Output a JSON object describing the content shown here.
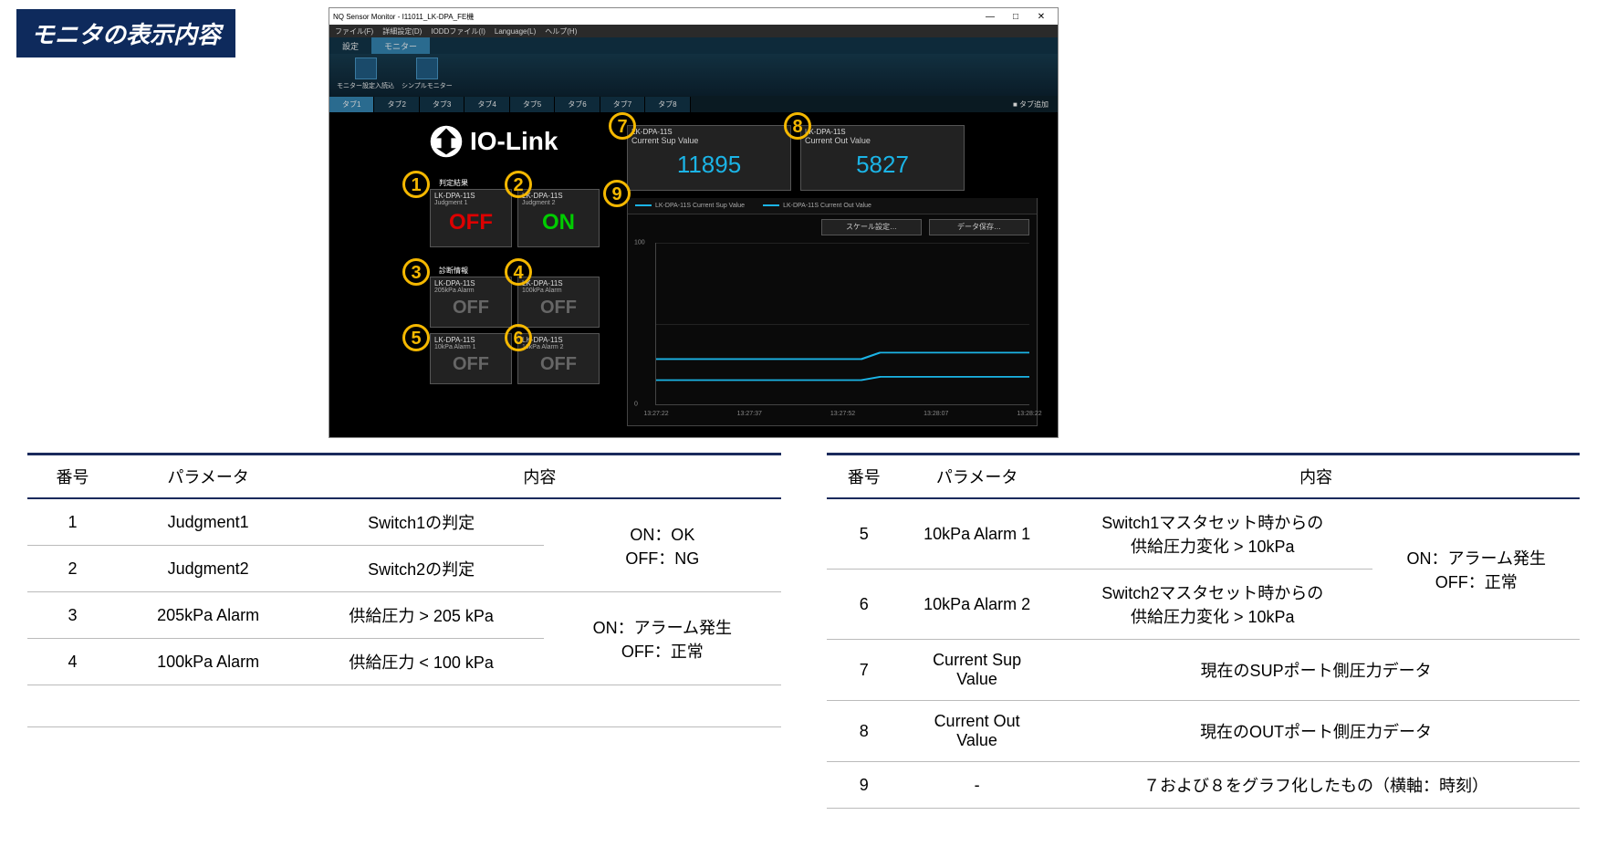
{
  "page_title": "モニタの表示内容",
  "window": {
    "title": "NQ Sensor Monitor - I11011_LK-DPA_FE機",
    "win_min": "—",
    "win_max": "□",
    "win_close": "✕",
    "menus": [
      "ファイル(F)",
      "詳細設定(D)",
      "IODDファイル(I)",
      "Language(L)",
      "ヘルプ(H)"
    ],
    "ribbon_tabs": [
      "設定",
      "モニター"
    ],
    "ribbon_items": [
      "モニター設定入読込",
      "シンプルモニター"
    ],
    "tabs": [
      "タブ1",
      "タブ2",
      "タブ3",
      "タブ4",
      "タブ5",
      "タブ6",
      "タブ7",
      "タブ8"
    ],
    "tab_add": "■ タブ追加"
  },
  "monitor": {
    "iolink_text": "IO-Link",
    "section_judgment": "判定結果",
    "section_diag": "診断情報",
    "panels": {
      "j1": {
        "model": "LK-DPA-11S",
        "sub": "Judgment 1",
        "value": "OFF"
      },
      "j2": {
        "model": "LK-DPA-11S",
        "sub": "Judgment 2",
        "value": "ON"
      },
      "d1": {
        "model": "LK-DPA-11S",
        "sub": "205kPa Alarm",
        "value": "OFF"
      },
      "d2": {
        "model": "LK-DPA-11S",
        "sub": "100kPa Alarm",
        "value": "OFF"
      },
      "d3": {
        "model": "LK-DPA-11S",
        "sub": "10kPa Alarm 1",
        "value": "OFF"
      },
      "d4": {
        "model": "LK-DPA-11S",
        "sub": "10kPa Alarm 2",
        "value": "OFF"
      },
      "sup": {
        "model": "LK-DPA-11S",
        "title": "Current Sup Value",
        "value": "11895"
      },
      "out": {
        "model": "LK-DPA-11S",
        "title": "Current Out Value",
        "value": "5827"
      }
    },
    "chart": {
      "legend1": "LK-DPA-11S Current Sup Value",
      "legend2": "LK-DPA-11S Current Out Value",
      "btn_scale": "スケール設定…",
      "btn_save": "データ保存…",
      "y_tick_100": "100",
      "y_tick_0": "0",
      "x_ticks": [
        "13:27:22",
        "13:27:37",
        "13:27:52",
        "13:28:07",
        "13:28:22"
      ]
    }
  },
  "chart_data": {
    "type": "line",
    "xlabel": "",
    "ylabel": "",
    "ylim": [
      0,
      100
    ],
    "x": [
      "13:27:22",
      "13:27:37",
      "13:27:52",
      "13:28:07",
      "13:28:22"
    ],
    "series": [
      {
        "name": "LK-DPA-11S Current Sup Value",
        "values": [
          28,
          28,
          28,
          32,
          32
        ]
      },
      {
        "name": "LK-DPA-11S Current Out Value",
        "values": [
          15,
          15,
          15,
          17,
          17
        ]
      }
    ]
  },
  "callouts": [
    "1",
    "2",
    "3",
    "4",
    "5",
    "6",
    "7",
    "8",
    "9"
  ],
  "table_headers": {
    "no": "番号",
    "param": "パラメータ",
    "desc": "内容"
  },
  "table_left": {
    "r1": {
      "no": "1",
      "param": "Judgment1",
      "desc": "Switch1の判定"
    },
    "r2": {
      "no": "2",
      "param": "Judgment2",
      "desc": "Switch2の判定"
    },
    "r3": {
      "no": "3",
      "param": "205kPa Alarm",
      "desc": "供給圧力 > 205 kPa"
    },
    "r4": {
      "no": "4",
      "param": "100kPa Alarm",
      "desc": "供給圧力 < 100 kPa"
    },
    "note12": "ON：OK\nOFF：NG",
    "note34": "ON：アラーム発生\nOFF：正常"
  },
  "table_right": {
    "r5": {
      "no": "5",
      "param": "10kPa Alarm 1",
      "desc": "Switch1マスタセット時からの\n供給圧力変化 > 10kPa"
    },
    "r6": {
      "no": "6",
      "param": "10kPa Alarm 2",
      "desc": "Switch2マスタセット時からの\n供給圧力変化 > 10kPa"
    },
    "r7": {
      "no": "7",
      "param": "Current Sup\nValue",
      "desc": "現在のSUPポート側圧力データ"
    },
    "r8": {
      "no": "8",
      "param": "Current Out\nValue",
      "desc": "現在のOUTポート側圧力データ"
    },
    "r9": {
      "no": "9",
      "param": "-",
      "desc": "７および８をグラフ化したもの（横軸：時刻）"
    },
    "note56": "ON：アラーム発生\nOFF：正常"
  }
}
